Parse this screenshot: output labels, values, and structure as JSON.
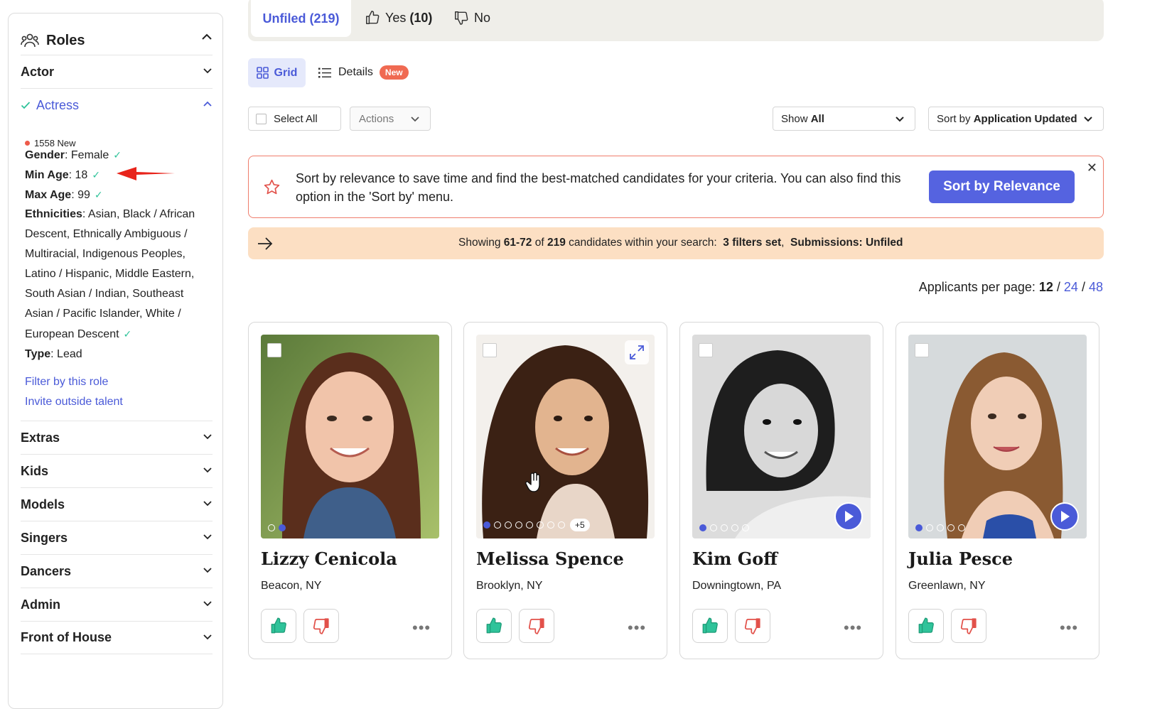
{
  "sidebar": {
    "title": "Roles",
    "actor_label": "Actor",
    "actress_label": "Actress",
    "new_count": "1558 New",
    "criteria": {
      "gender_label": "Gender",
      "gender_value": ": Female",
      "min_age_label": "Min Age",
      "min_age_value": ": 18",
      "max_age_label": "Max Age",
      "max_age_value": ": 99",
      "ethnicities_label": "Ethnicities",
      "ethnicities_value": ": Asian, Black / African Descent, Ethnically Ambiguous / Multiracial, Indigenous Peoples, Latino / Hispanic, Middle Eastern, South Asian / Indian, Southeast Asian / Pacific Islander, White / European Descent",
      "type_label": "Type",
      "type_value": ": Lead"
    },
    "filter_link": "Filter by this role",
    "invite_link": "Invite outside talent",
    "categories": [
      "Extras",
      "Kids",
      "Models",
      "Singers",
      "Dancers",
      "Admin",
      "Front of House"
    ]
  },
  "tabs": {
    "unfiled_label": "Unfiled",
    "unfiled_count": "(219)",
    "yes_label": "Yes",
    "yes_count": "(10)",
    "no_label": "No"
  },
  "views": {
    "grid": "Grid",
    "details": "Details",
    "new_badge": "New"
  },
  "controls": {
    "select_all": "Select All",
    "actions": "Actions",
    "show_prefix": "Show",
    "show_value": "All",
    "sort_prefix": "Sort by",
    "sort_value": "Application Updated"
  },
  "relevance": {
    "text": "Sort by relevance to save time and find the best-matched candidates for your criteria. You can also find this option in the 'Sort by' menu.",
    "button": "Sort by Relevance",
    "close": "✕"
  },
  "showing": {
    "prefix": "Showing ",
    "range": "61-72",
    "of": " of ",
    "total": "219",
    "mid": " candidates within your search:  ",
    "filters": "3 filters set",
    "sep": ",  ",
    "submissions": "Submissions: Unfiled"
  },
  "per_page": {
    "label": "Applicants per page: ",
    "current": "12",
    "sep": " / ",
    "opt2": "24",
    "opt3": "48"
  },
  "candidates": [
    {
      "name": "Lizzy Cenicola",
      "location": "Beacon, NY",
      "more_photos": ""
    },
    {
      "name": "Melissa Spence",
      "location": "Brooklyn, NY",
      "more_photos": "+5"
    },
    {
      "name": "Kim Goff",
      "location": "Downingtown, PA",
      "more_photos": ""
    },
    {
      "name": "Julia Pesce",
      "location": "Greenlawn, NY",
      "more_photos": ""
    }
  ],
  "colors": {
    "accent": "#4a5ad8",
    "yes": "#2fc39a",
    "no": "#e2514a",
    "alert": "#ef7d6c",
    "info": "#fcdfc3"
  }
}
